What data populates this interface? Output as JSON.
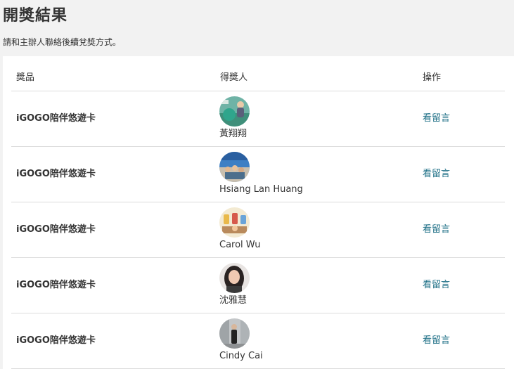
{
  "page": {
    "title": "開獎結果",
    "subtitle": "請和主辦人聯絡後續兌獎方式。"
  },
  "table": {
    "headers": {
      "prize": "獎品",
      "winner": "得獎人",
      "action": "操作"
    },
    "rows": [
      {
        "prize": "iGOGO陪伴悠遊卡",
        "winner": "黃翔翔",
        "action": "看留言",
        "avatar_icon": "avatar-photo-icon"
      },
      {
        "prize": "iGOGO陪伴悠遊卡",
        "winner": "Hsiang Lan Huang",
        "action": "看留言",
        "avatar_icon": "avatar-photo-icon"
      },
      {
        "prize": "iGOGO陪伴悠遊卡",
        "winner": "Carol Wu",
        "action": "看留言",
        "avatar_icon": "avatar-photo-icon"
      },
      {
        "prize": "iGOGO陪伴悠遊卡",
        "winner": "沈雅慧",
        "action": "看留言",
        "avatar_icon": "avatar-photo-icon"
      },
      {
        "prize": "iGOGO陪伴悠遊卡",
        "winner": "Cindy Cai",
        "action": "看留言",
        "avatar_icon": "avatar-photo-icon"
      }
    ]
  },
  "colors": {
    "background": "#f2f2f2",
    "card": "#ffffff",
    "link": "#1d6f86",
    "divider": "#dcdcdc",
    "text": "#333333"
  }
}
